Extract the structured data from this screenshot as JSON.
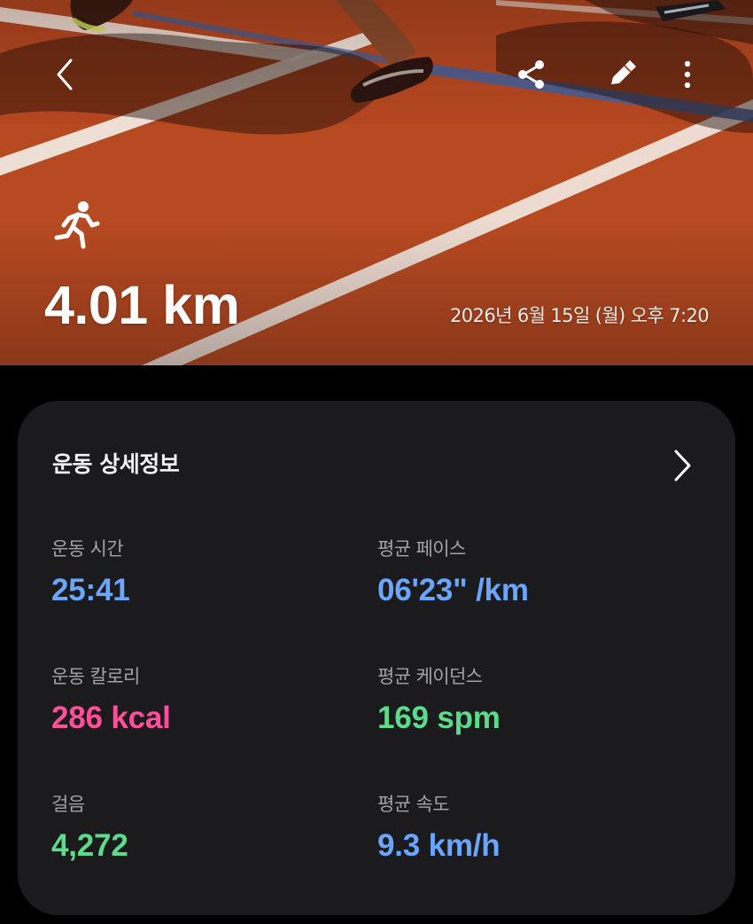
{
  "hero": {
    "distance": "4.01 km",
    "datetime": "2026년 6월 15일 (월) 오후 7:20",
    "icons": {
      "back": "back-arrow-icon",
      "share": "share-icon",
      "edit": "pencil-icon",
      "more": "more-vertical-icon",
      "activity": "running-person-icon"
    }
  },
  "details": {
    "title": "운동 상세정보",
    "stats": [
      {
        "label": "운동 시간",
        "value": "25:41",
        "color": "#6aa5ff"
      },
      {
        "label": "평균 페이스",
        "value": "06'23\" /km",
        "color": "#6aa5ff"
      },
      {
        "label": "운동 칼로리",
        "value": "286 kcal",
        "color": "#ff4f9a"
      },
      {
        "label": "평균 케이던스",
        "value": "169 spm",
        "color": "#5bdc8a"
      },
      {
        "label": "걸음",
        "value": "4,272",
        "color": "#5bdc8a"
      },
      {
        "label": "평균 속도",
        "value": "9.3 km/h",
        "color": "#6aa5ff"
      }
    ]
  },
  "colors": {
    "background": "#000000",
    "card": "#1b1b1d",
    "track": "#b84a22",
    "track_line": "#f4efe9",
    "lane_blue": "#3f5f9c"
  }
}
